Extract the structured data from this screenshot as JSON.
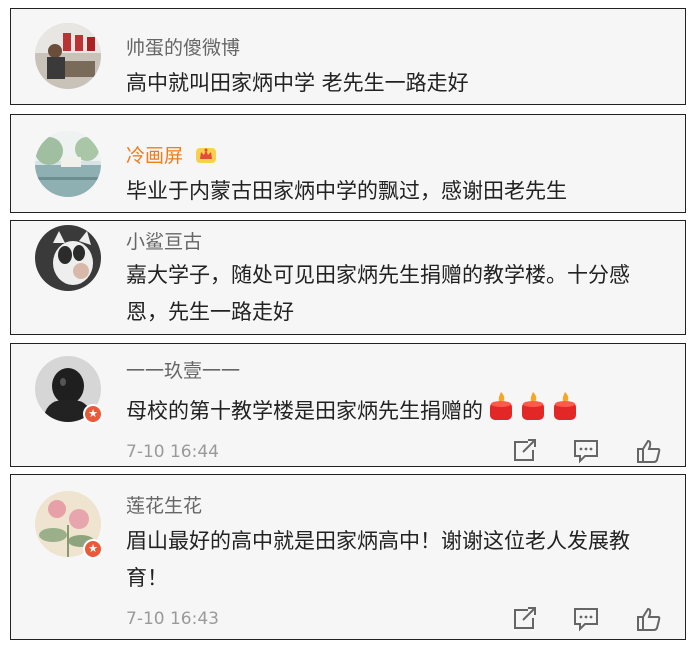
{
  "comments": [
    {
      "username": "帅蛋的傻微博",
      "text": "高中就叫田家炳中学 老先生一路走好"
    },
    {
      "username": "冷画屏",
      "text": "毕业于内蒙古田家炳中学的飘过，感谢田老先生",
      "username_color": "#ef7d1a",
      "badge_icon": "crown-icon"
    },
    {
      "username": "小鲨亘古",
      "text": "嘉大学子，随处可见田家炳先生捐赠的教学楼。十分感恩，先生一路走好"
    },
    {
      "username": "一一玖壹一一",
      "text": "母校的第十教学楼是田家炳先生捐赠的",
      "emoji": [
        "candle-icon",
        "candle-icon",
        "candle-icon"
      ],
      "time": "7-10 16:44"
    },
    {
      "username": "莲花生花",
      "text": "眉山最好的高中就是田家炳高中！谢谢这位老人发展教育！",
      "time": "7-10 16:43"
    }
  ],
  "actions": [
    "share-icon",
    "comment-icon",
    "like-icon"
  ],
  "colors": {
    "verified_badge": "#ea5a3a",
    "vip_name": "#ef7d1a",
    "card_bg": "#f6f6f6"
  }
}
